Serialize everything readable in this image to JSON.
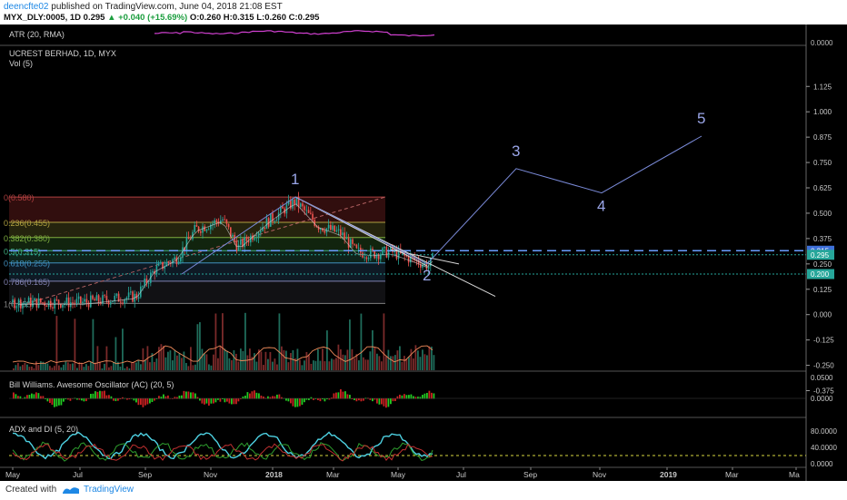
{
  "header": {
    "user": "deencfte02",
    "published": " published on TradingView.com, June 04, 2018 21:08 EST",
    "symbol": "MYX_DLY:0005, 1D",
    "price": "0.295",
    "change": "+0.040 (+15.69%)",
    "open": "O:0.260",
    "high": "H:0.315",
    "low": "L:0.260",
    "close": "C:0.295"
  },
  "footer": {
    "created": "Created with",
    "brand": "TradingView"
  },
  "colors": {
    "accent": "#1e88e5",
    "up": "#26a69a",
    "down": "#ef5350",
    "atr": "#d040d0",
    "wave": "#7a8ad8",
    "adx": "#4dd0e1"
  },
  "chart_data": [
    {
      "type": "line",
      "title": "ATR (20, RMA)",
      "y_axis_labels": [
        "0.0000"
      ]
    },
    {
      "type": "line",
      "title": "UCREST BERHAD, 1D, MYX",
      "subtitle": "Vol (5)",
      "x_tick_labels": [
        "May",
        "Jul",
        "Sep",
        "Nov",
        "2018",
        "Mar",
        "May",
        "Jul",
        "Sep",
        "Nov",
        "2019",
        "Mar",
        "Ma"
      ],
      "y_tick_labels": [
        "1.125",
        "1.000",
        "0.875",
        "0.750",
        "0.625",
        "0.500",
        "0.375",
        "0.250",
        "0.125",
        "0.000",
        "-0.125",
        "-0.250",
        "-0.375"
      ],
      "ylim": [
        -0.375,
        1.125
      ],
      "price_badges": [
        "0.315",
        "0.295",
        "0.200"
      ],
      "fibonacci": [
        {
          "label": "0(0.580)",
          "value": 0.58
        },
        {
          "label": "0.236(0.455)",
          "value": 0.455
        },
        {
          "label": "0.382(0.380)",
          "value": 0.38
        },
        {
          "label": "0.5(0.315)",
          "value": 0.315
        },
        {
          "label": "0.618(0.255)",
          "value": 0.255
        },
        {
          "label": "0.786(0.165)",
          "value": 0.165
        },
        {
          "label": "1(0.055)",
          "value": 0.055
        }
      ],
      "elliott_wave_labels": [
        {
          "label": "1",
          "value": 0.58
        },
        {
          "label": "2",
          "value": 0.25
        },
        {
          "label": "3",
          "value": 0.72
        },
        {
          "label": "4",
          "value": 0.6
        },
        {
          "label": "5",
          "value": 0.88
        }
      ]
    },
    {
      "type": "bar",
      "title": "Bill Williams. Awesome Oscillator (AC) (20, 5)",
      "y_tick_labels": [
        "0.0500",
        "0.0000"
      ]
    },
    {
      "type": "line",
      "title": "ADX and DI (5, 20)",
      "y_tick_labels": [
        "80.0000",
        "40.0000",
        "0.0000"
      ]
    }
  ]
}
